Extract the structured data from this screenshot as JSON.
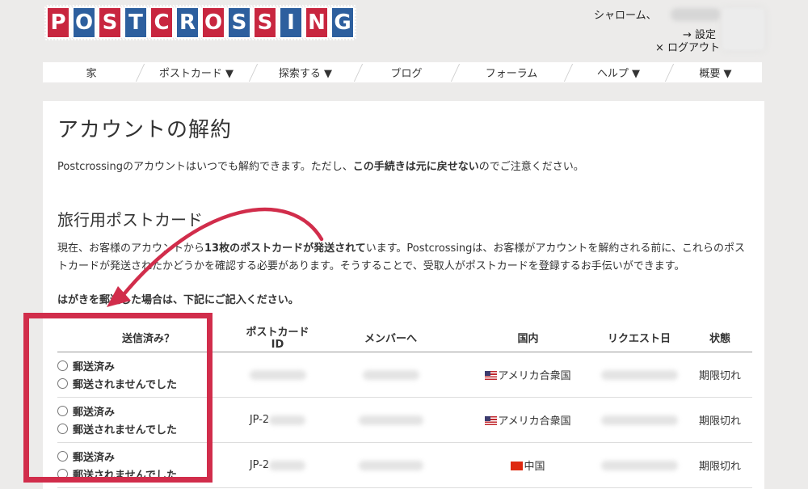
{
  "logo": {
    "letters": [
      "P",
      "O",
      "S",
      "T",
      "C",
      "R",
      "O",
      "S",
      "S",
      "I",
      "N",
      "G"
    ],
    "alt": "POSTCROSSING"
  },
  "header": {
    "greeting": "シャローム、",
    "settings_label": "→ 設定",
    "logout_label": "× ログアウト"
  },
  "nav": {
    "items": [
      {
        "label": "家"
      },
      {
        "label": "ポストカード ▼"
      },
      {
        "label": "探索する ▼"
      },
      {
        "label": "ブログ"
      },
      {
        "label": "フォーラム"
      },
      {
        "label": "ヘルプ ▼"
      },
      {
        "label": "概要 ▼"
      }
    ]
  },
  "page": {
    "title": "アカウントの解約",
    "intro_pre": "Postcrossingのアカウントはいつでも解約できます。ただし、",
    "intro_bold": "この手続きは元に戻せない",
    "intro_post": "のでご注意ください。",
    "section_title": "旅行用ポストカード",
    "para_pre": "現在、お客様のアカウントから",
    "para_bold": "13枚のポストカードが発送されて",
    "para_post": "います。Postcrossingは、お客様がアカウントを解約される前に、これらのポストカードが発送されたかどうかを確認する必要があります。そうすることで、受取人がポストカードを登録するお手伝いができます。",
    "note": "はがきを郵送した場合は、下記にご記入ください。"
  },
  "table": {
    "headers": [
      "送信済み？",
      "ポストカードID",
      "メンバーへ",
      "国内",
      "リクエスト日",
      "状態"
    ],
    "rows": [
      {
        "sent_label": "郵送済み",
        "not_sent_label": "郵送されませんでした",
        "postcard_id": "",
        "country": "アメリカ合衆国",
        "flag": "us",
        "status": "期限切れ"
      },
      {
        "sent_label": "郵送済み",
        "not_sent_label": "郵送されませんでした",
        "postcard_id": "JP-2",
        "country": "アメリカ合衆国",
        "flag": "us",
        "status": "期限切れ"
      },
      {
        "sent_label": "郵送済み",
        "not_sent_label": "郵送されませんでした",
        "postcard_id": "JP-2",
        "country": "中国",
        "flag": "cn",
        "status": "期限切れ"
      }
    ]
  },
  "colors": {
    "accent_red": "#d12d4b",
    "logo_blue": "#2d5f9e",
    "logo_red": "#c8263f",
    "background": "#ecebea"
  },
  "annotation": {
    "arrow_color": "#d12d4b",
    "box_color": "#d12d4b"
  }
}
